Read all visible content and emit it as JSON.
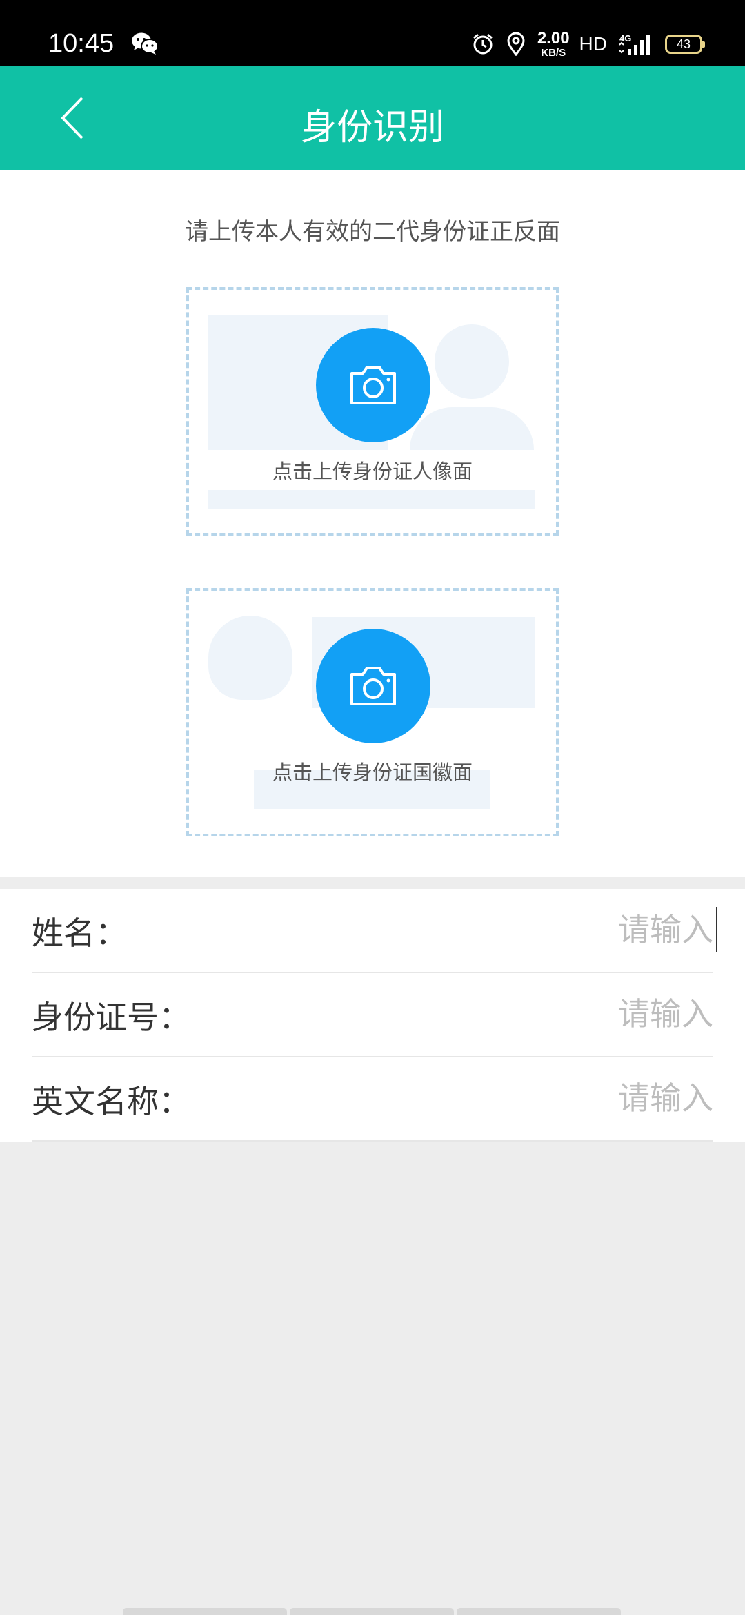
{
  "status_bar": {
    "time": "10:45",
    "net_speed_value": "2.00",
    "net_speed_unit": "KB/S",
    "hd": "HD",
    "network": "4G",
    "battery": "43",
    "icons": [
      "wechat-icon",
      "alarm-icon",
      "location-icon",
      "signal-icon"
    ]
  },
  "header": {
    "title": "身份识别",
    "back_icon": "chevron-left-icon"
  },
  "upload": {
    "tip": "请上传本人有效的二代身份证正反面",
    "front_label": "点击上传身份证人像面",
    "back_label": "点击上传身份证国徽面",
    "camera_icon": "camera-icon"
  },
  "form": {
    "fields": [
      {
        "label": "姓名：",
        "placeholder": "请输入",
        "value": ""
      },
      {
        "label": "身份证号：",
        "placeholder": "请输入",
        "value": ""
      },
      {
        "label": "英文名称：",
        "placeholder": "请输入",
        "value": ""
      }
    ]
  },
  "colors": {
    "header_bg": "#10c1a5",
    "camera_button": "#12a0f5",
    "dashed_border": "#b6d5ea",
    "placeholder_block": "#eef4fa",
    "page_bg": "#ededed"
  }
}
